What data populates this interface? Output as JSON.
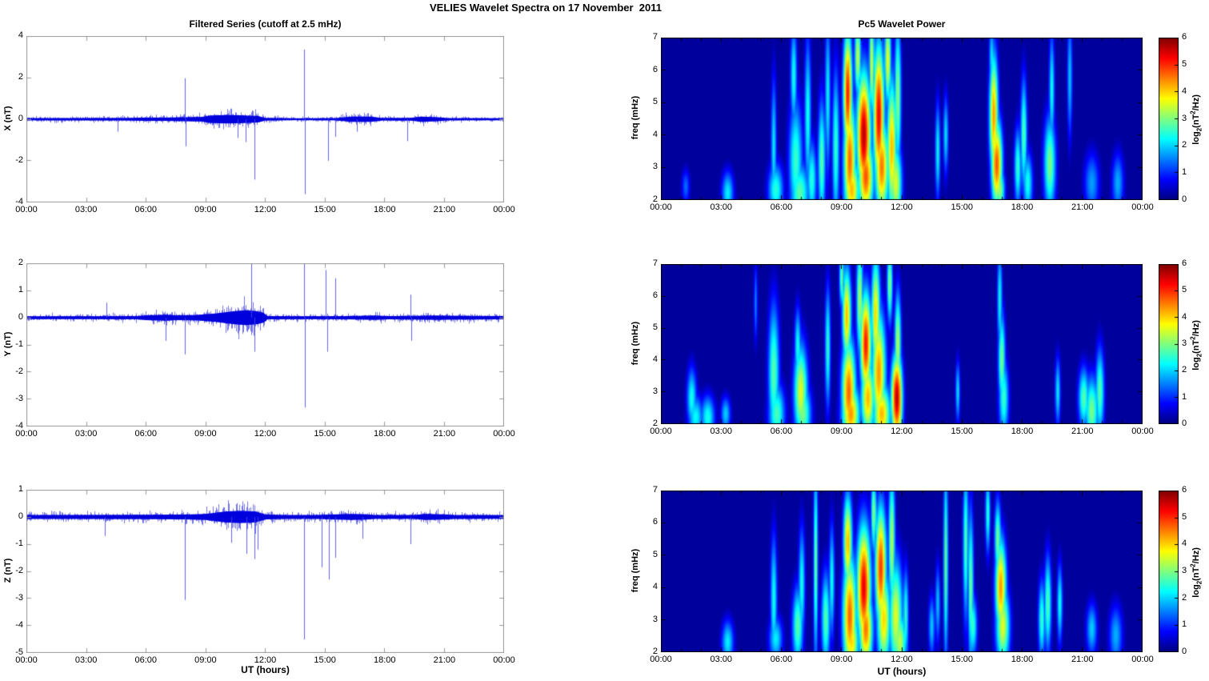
{
  "figure": {
    "title": "VELIES Wavelet Spectra on 17 November  2011",
    "background": "#ffffff"
  },
  "time_axis": {
    "xlabel": "UT (hours)",
    "tick_hours": [
      0,
      3,
      6,
      9,
      12,
      15,
      18,
      21,
      24
    ],
    "tick_labels": [
      "00:00",
      "03:00",
      "06:00",
      "09:00",
      "12:00",
      "15:00",
      "18:00",
      "21:00",
      "00:00"
    ]
  },
  "colorbar": {
    "label_prefix": "log",
    "label_sub": "2",
    "label_mid": "(nT",
    "label_sup": "2",
    "label_suffix": "/Hz)",
    "tick_values": [
      6,
      5,
      4,
      3,
      2,
      1,
      0
    ],
    "range": [
      0,
      6
    ],
    "colormap": "jet"
  },
  "colors": {
    "series_line": "#0000dd",
    "spike_line": "#4646f0",
    "left_frame": "#999999",
    "right_frame": "#000000",
    "heatmap_low": "#00008f",
    "text": "#000000"
  },
  "chart_data": [
    {
      "type": "line",
      "panel": "left-top",
      "title": "Filtered Series (cutoff at 2.5 mHz)",
      "ylabel": "X (nT)",
      "ylim": [
        -4,
        4
      ],
      "yticks": [
        4,
        2,
        0,
        -2,
        -4
      ],
      "xlim_hours": [
        0,
        24
      ],
      "noise_envelope_format": "[t_hours, band_half_width_nT]",
      "noise_envelope": [
        [
          0,
          0.12
        ],
        [
          3,
          0.13
        ],
        [
          5,
          0.14
        ],
        [
          6,
          0.18
        ],
        [
          7,
          0.18
        ],
        [
          8,
          0.22
        ],
        [
          8.8,
          0.25
        ],
        [
          9.2,
          0.4
        ],
        [
          10,
          0.45
        ],
        [
          10.8,
          0.42
        ],
        [
          11.6,
          0.35
        ],
        [
          12,
          0.14
        ],
        [
          13.5,
          0.1
        ],
        [
          15.5,
          0.12
        ],
        [
          16.3,
          0.28
        ],
        [
          17.3,
          0.28
        ],
        [
          17.8,
          0.14
        ],
        [
          19.3,
          0.15
        ],
        [
          19.8,
          0.28
        ],
        [
          20.6,
          0.22
        ],
        [
          21.2,
          0.12
        ],
        [
          24,
          0.11
        ]
      ],
      "spikes_format": "[t_hours, peak_nT]",
      "spikes": [
        [
          4.6,
          -0.6
        ],
        [
          7.95,
          1.97
        ],
        [
          8.0,
          -1.3
        ],
        [
          10.6,
          -0.9
        ],
        [
          11.0,
          -1.1
        ],
        [
          11.45,
          -2.9
        ],
        [
          13.95,
          3.35
        ],
        [
          14.0,
          -3.6
        ],
        [
          15.15,
          -2.0
        ],
        [
          15.5,
          -0.85
        ],
        [
          16.6,
          -0.6
        ],
        [
          19.15,
          -1.05
        ]
      ]
    },
    {
      "type": "line",
      "panel": "left-middle",
      "ylabel": "Y (nT)",
      "ylim": [
        -4,
        2
      ],
      "yticks": [
        2,
        1,
        0,
        -1,
        -2,
        -3,
        -4
      ],
      "xlim_hours": [
        0,
        24
      ],
      "noise_envelope": [
        [
          0,
          0.12
        ],
        [
          3,
          0.12
        ],
        [
          5.5,
          0.13
        ],
        [
          6,
          0.2
        ],
        [
          6.5,
          0.22
        ],
        [
          7,
          0.25
        ],
        [
          7.5,
          0.2
        ],
        [
          8.5,
          0.22
        ],
        [
          9,
          0.28
        ],
        [
          9.5,
          0.35
        ],
        [
          10,
          0.45
        ],
        [
          10.5,
          0.55
        ],
        [
          11,
          0.6
        ],
        [
          11.5,
          0.55
        ],
        [
          11.9,
          0.4
        ],
        [
          12.1,
          0.13
        ],
        [
          14,
          0.12
        ],
        [
          16,
          0.13
        ],
        [
          17.5,
          0.18
        ],
        [
          18.2,
          0.13
        ],
        [
          19.8,
          0.16
        ],
        [
          20.5,
          0.18
        ],
        [
          21.5,
          0.16
        ],
        [
          24,
          0.13
        ]
      ],
      "spikes": [
        [
          4.0,
          0.55
        ],
        [
          7.0,
          -0.85
        ],
        [
          7.95,
          -1.35
        ],
        [
          11.3,
          2.05
        ],
        [
          11.45,
          -1.25
        ],
        [
          13.95,
          2.0
        ],
        [
          14.0,
          -3.3
        ],
        [
          15.05,
          1.75
        ],
        [
          15.1,
          -1.25
        ],
        [
          15.5,
          1.45
        ],
        [
          19.3,
          0.85
        ],
        [
          19.35,
          -0.85
        ]
      ]
    },
    {
      "type": "line",
      "panel": "left-bottom",
      "ylabel": "Z (nT)",
      "xlabel": "UT (hours)",
      "ylim": [
        -5,
        1
      ],
      "yticks": [
        1,
        0,
        -1,
        -2,
        -3,
        -4,
        -5
      ],
      "xlim_hours": [
        0,
        24
      ],
      "noise_envelope": [
        [
          0,
          0.16
        ],
        [
          4,
          0.17
        ],
        [
          6,
          0.18
        ],
        [
          8,
          0.2
        ],
        [
          9,
          0.25
        ],
        [
          9.5,
          0.35
        ],
        [
          10,
          0.45
        ],
        [
          10.7,
          0.5
        ],
        [
          11.5,
          0.45
        ],
        [
          12,
          0.2
        ],
        [
          13,
          0.16
        ],
        [
          14.5,
          0.16
        ],
        [
          16.3,
          0.25
        ],
        [
          17,
          0.22
        ],
        [
          17.5,
          0.16
        ],
        [
          19.5,
          0.16
        ],
        [
          20,
          0.25
        ],
        [
          20.8,
          0.22
        ],
        [
          21.5,
          0.16
        ],
        [
          24,
          0.15
        ]
      ],
      "spikes": [
        [
          3.95,
          -0.7
        ],
        [
          7.95,
          -3.05
        ],
        [
          10.3,
          -0.95
        ],
        [
          11.05,
          -1.35
        ],
        [
          11.45,
          -1.55
        ],
        [
          11.6,
          -1.2
        ],
        [
          13.95,
          -4.5
        ],
        [
          14.85,
          -1.85
        ],
        [
          15.2,
          -2.3
        ],
        [
          15.5,
          -1.5
        ],
        [
          16.9,
          -0.8
        ],
        [
          19.3,
          -1.0
        ]
      ]
    },
    {
      "type": "heatmap",
      "panel": "right-top",
      "title": "Pc5 Wavelet Power",
      "ylabel": "freq (mHz)",
      "ylim": [
        2,
        7
      ],
      "yticks": [
        7,
        6,
        5,
        4,
        3,
        2
      ],
      "xlim_hours": [
        0,
        24
      ],
      "value_range": [
        0,
        6
      ],
      "features_format": "[t_hours, freq_mHz, sigma_t_hours, sigma_f_mHz, peak_log2_power]",
      "features": [
        [
          1.2,
          2.4,
          0.15,
          0.4,
          1.4
        ],
        [
          3.3,
          2.2,
          0.22,
          0.5,
          2.2
        ],
        [
          5.6,
          3.6,
          0.1,
          1.6,
          2.2
        ],
        [
          5.7,
          2.3,
          0.28,
          0.6,
          2.5
        ],
        [
          6.6,
          5.8,
          0.12,
          1.2,
          2.4
        ],
        [
          6.7,
          3.2,
          0.25,
          1.4,
          2.6
        ],
        [
          6.9,
          2.2,
          0.35,
          0.7,
          2.8
        ],
        [
          7.3,
          4.6,
          0.12,
          1.8,
          2.4
        ],
        [
          7.5,
          2.6,
          0.18,
          0.9,
          2.5
        ],
        [
          8.0,
          3.2,
          0.14,
          1.4,
          2.8
        ],
        [
          8.3,
          5.2,
          0.1,
          1.8,
          2.3
        ],
        [
          8.7,
          3.6,
          0.13,
          1.8,
          2.6
        ],
        [
          9.3,
          5.3,
          0.16,
          1.4,
          5.2
        ],
        [
          9.4,
          3.2,
          0.22,
          1.4,
          4.7
        ],
        [
          9.5,
          2.3,
          0.28,
          0.7,
          4.2
        ],
        [
          9.8,
          6.4,
          0.12,
          0.9,
          3.5
        ],
        [
          10.1,
          4.0,
          0.25,
          1.4,
          5.7
        ],
        [
          10.2,
          2.7,
          0.28,
          0.9,
          4.8
        ],
        [
          10.5,
          6.2,
          0.1,
          1.2,
          3.6
        ],
        [
          10.85,
          4.6,
          0.2,
          1.6,
          5.4
        ],
        [
          11.0,
          3.0,
          0.25,
          1.1,
          4.6
        ],
        [
          11.3,
          6.3,
          0.12,
          1.0,
          3.8
        ],
        [
          11.5,
          3.6,
          0.18,
          1.6,
          4.2
        ],
        [
          11.7,
          2.5,
          0.22,
          0.9,
          3.6
        ],
        [
          11.8,
          5.2,
          0.12,
          1.7,
          3.2
        ],
        [
          13.8,
          3.5,
          0.09,
          1.1,
          2.4
        ],
        [
          14.2,
          4.0,
          0.09,
          0.9,
          2.2
        ],
        [
          16.5,
          6.4,
          0.1,
          0.8,
          2.2
        ],
        [
          16.6,
          4.6,
          0.16,
          1.4,
          4.4
        ],
        [
          16.75,
          3.1,
          0.2,
          1.0,
          4.8
        ],
        [
          16.9,
          2.3,
          0.18,
          0.5,
          3.2
        ],
        [
          17.8,
          3.0,
          0.13,
          0.9,
          2.6
        ],
        [
          18.1,
          4.0,
          0.12,
          1.3,
          2.8
        ],
        [
          18.3,
          2.5,
          0.18,
          0.7,
          2.4
        ],
        [
          19.4,
          3.1,
          0.22,
          1.1,
          3.0
        ],
        [
          19.5,
          5.4,
          0.1,
          1.3,
          2.4
        ],
        [
          20.4,
          5.8,
          0.09,
          1.4,
          2.0
        ],
        [
          21.5,
          2.5,
          0.28,
          0.7,
          1.7
        ],
        [
          22.8,
          2.5,
          0.22,
          0.7,
          1.8
        ]
      ]
    },
    {
      "type": "heatmap",
      "panel": "right-middle",
      "ylabel": "freq (mHz)",
      "ylim": [
        2,
        7
      ],
      "yticks": [
        7,
        6,
        5,
        4,
        3,
        2
      ],
      "xlim_hours": [
        0,
        24
      ],
      "value_range": [
        0,
        6
      ],
      "features": [
        [
          1.5,
          2.8,
          0.18,
          0.7,
          2.4
        ],
        [
          1.7,
          2.2,
          0.28,
          0.5,
          2.3
        ],
        [
          2.3,
          2.2,
          0.26,
          0.5,
          2.4
        ],
        [
          3.2,
          2.3,
          0.18,
          0.4,
          2.0
        ],
        [
          4.7,
          5.8,
          0.07,
          0.9,
          1.6
        ],
        [
          5.6,
          3.6,
          0.2,
          1.6,
          2.8
        ],
        [
          5.75,
          2.3,
          0.3,
          0.7,
          2.7
        ],
        [
          6.8,
          4.4,
          0.12,
          0.9,
          2.4
        ],
        [
          6.95,
          3.0,
          0.25,
          1.1,
          3.6
        ],
        [
          7.05,
          2.3,
          0.3,
          0.7,
          3.0
        ],
        [
          8.3,
          4.4,
          0.1,
          1.4,
          2.6
        ],
        [
          9.0,
          6.6,
          0.09,
          0.7,
          3.0
        ],
        [
          9.25,
          5.4,
          0.16,
          1.1,
          4.2
        ],
        [
          9.35,
          3.0,
          0.25,
          1.2,
          4.7
        ],
        [
          9.45,
          2.3,
          0.32,
          0.7,
          4.4
        ],
        [
          9.9,
          5.9,
          0.12,
          1.3,
          3.4
        ],
        [
          10.2,
          4.5,
          0.2,
          1.2,
          5.2
        ],
        [
          10.3,
          2.8,
          0.25,
          0.9,
          4.2
        ],
        [
          10.7,
          5.4,
          0.16,
          1.4,
          4.0
        ],
        [
          10.85,
          3.6,
          0.25,
          1.4,
          4.4
        ],
        [
          11.0,
          2.3,
          0.32,
          0.7,
          4.2
        ],
        [
          11.4,
          6.4,
          0.1,
          0.9,
          3.2
        ],
        [
          11.75,
          2.8,
          0.2,
          1.0,
          5.7
        ],
        [
          11.8,
          4.5,
          0.12,
          1.2,
          3.4
        ],
        [
          14.8,
          3.0,
          0.08,
          0.7,
          2.2
        ],
        [
          16.9,
          5.9,
          0.09,
          1.2,
          2.4
        ],
        [
          17.0,
          4.0,
          0.13,
          1.1,
          3.0
        ],
        [
          17.1,
          2.8,
          0.18,
          0.9,
          2.6
        ],
        [
          19.8,
          3.0,
          0.1,
          0.8,
          2.2
        ],
        [
          21.1,
          2.8,
          0.2,
          0.7,
          2.8
        ],
        [
          21.5,
          2.4,
          0.25,
          0.8,
          3.0
        ],
        [
          21.9,
          3.0,
          0.16,
          1.0,
          2.8
        ]
      ]
    },
    {
      "type": "heatmap",
      "panel": "right-bottom",
      "ylabel": "freq (mHz)",
      "xlabel": "UT (hours)",
      "ylim": [
        2,
        7
      ],
      "yticks": [
        7,
        6,
        5,
        4,
        3,
        2
      ],
      "xlim_hours": [
        0,
        24
      ],
      "value_range": [
        0,
        6
      ],
      "features": [
        [
          3.3,
          2.3,
          0.22,
          0.5,
          2.2
        ],
        [
          5.6,
          3.6,
          0.12,
          1.5,
          2.4
        ],
        [
          5.7,
          2.4,
          0.25,
          0.5,
          2.2
        ],
        [
          6.8,
          2.8,
          0.2,
          0.9,
          2.8
        ],
        [
          7.0,
          4.1,
          0.12,
          1.3,
          2.4
        ],
        [
          7.7,
          4.8,
          0.08,
          2.3,
          3.0
        ],
        [
          8.2,
          3.0,
          0.16,
          1.1,
          2.8
        ],
        [
          8.5,
          4.2,
          0.1,
          1.3,
          2.4
        ],
        [
          9.3,
          5.4,
          0.16,
          1.1,
          4.2
        ],
        [
          9.4,
          3.1,
          0.25,
          1.4,
          4.7
        ],
        [
          9.5,
          2.3,
          0.25,
          0.7,
          4.0
        ],
        [
          10.1,
          4.0,
          0.25,
          1.4,
          5.4
        ],
        [
          10.2,
          2.7,
          0.25,
          0.9,
          4.6
        ],
        [
          10.6,
          6.3,
          0.1,
          0.9,
          3.2
        ],
        [
          10.95,
          4.6,
          0.2,
          1.4,
          5.0
        ],
        [
          11.1,
          3.0,
          0.25,
          1.1,
          4.0
        ],
        [
          11.5,
          5.4,
          0.12,
          1.6,
          3.4
        ],
        [
          11.7,
          3.1,
          0.25,
          1.3,
          3.6
        ],
        [
          11.9,
          2.3,
          0.25,
          0.7,
          3.4
        ],
        [
          12.2,
          3.1,
          0.1,
          1.1,
          2.6
        ],
        [
          13.5,
          2.8,
          0.12,
          0.7,
          2.0
        ],
        [
          13.8,
          3.5,
          0.09,
          0.9,
          2.0
        ],
        [
          14.2,
          4.8,
          0.08,
          2.3,
          3.0
        ],
        [
          15.2,
          5.4,
          0.1,
          1.8,
          2.8
        ],
        [
          15.45,
          4.0,
          0.1,
          1.8,
          3.0
        ],
        [
          15.55,
          2.8,
          0.16,
          0.7,
          2.6
        ],
        [
          16.3,
          6.3,
          0.09,
          0.9,
          2.6
        ],
        [
          16.8,
          5.5,
          0.12,
          0.9,
          3.0
        ],
        [
          16.95,
          4.0,
          0.2,
          1.1,
          4.4
        ],
        [
          17.05,
          2.8,
          0.25,
          0.9,
          3.6
        ],
        [
          19.0,
          3.0,
          0.13,
          0.9,
          2.6
        ],
        [
          19.3,
          3.5,
          0.13,
          1.1,
          2.8
        ],
        [
          19.9,
          3.5,
          0.1,
          0.9,
          2.4
        ],
        [
          21.5,
          2.7,
          0.2,
          0.6,
          2.0
        ],
        [
          22.7,
          2.5,
          0.25,
          0.7,
          1.8
        ]
      ]
    }
  ]
}
